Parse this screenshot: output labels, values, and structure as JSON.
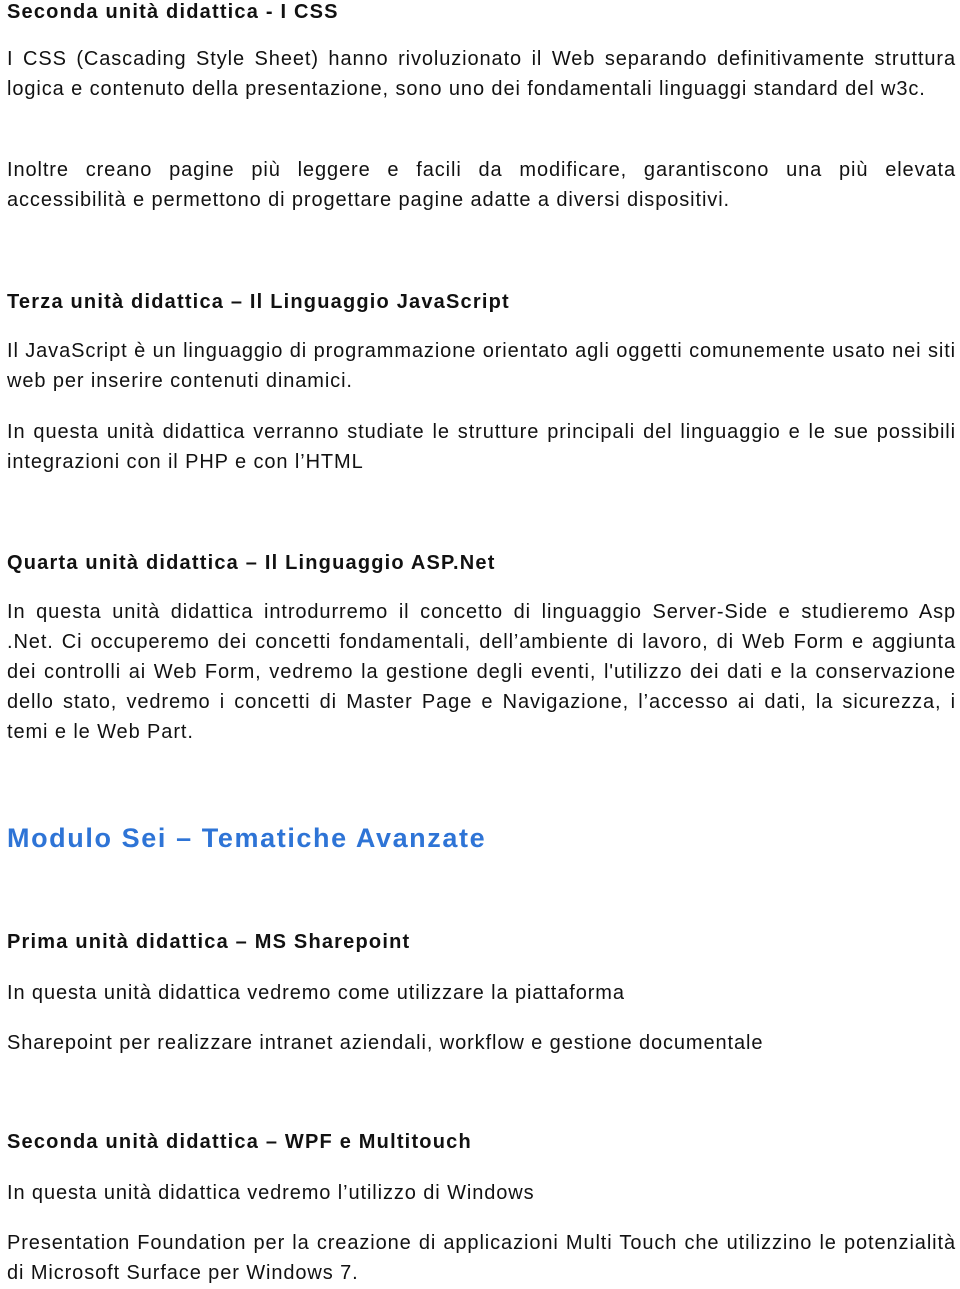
{
  "sections": [
    {
      "heading": "Seconda unità didattica - I CSS",
      "paragraphs": [
        "I CSS (Cascading Style Sheet) hanno rivoluzionato il Web separando definitivamente struttura logica e contenuto della presentazione, sono uno dei fondamentali linguaggi standard del w3c.",
        "Inoltre creano pagine più leggere e facili da modificare, garantiscono una più elevata accessibilità e permettono di progettare pagine adatte a diversi dispositivi."
      ]
    },
    {
      "heading": "Terza unità didattica – Il Linguaggio JavaScript",
      "paragraphs": [
        "Il JavaScript è un linguaggio di programmazione orientato agli oggetti comunemente usato nei siti web per inserire contenuti dinamici.",
        "In questa unità didattica verranno studiate le strutture principali del linguaggio e le sue possibili integrazioni con il PHP e con l’HTML"
      ]
    },
    {
      "heading": "Quarta unità didattica – Il Linguaggio ASP.Net",
      "paragraphs": [
        "In questa unità didattica introdurremo il concetto di linguaggio Server-Side e studieremo Asp .Net. Ci occuperemo dei concetti fondamentali, dell’ambiente di lavoro, di Web Form e aggiunta dei controlli ai Web Form, vedremo la gestione degli eventi, l'utilizzo dei dati e la conservazione dello stato, vedremo i concetti di Master Page e Navigazione, l’accesso ai dati, la sicurezza, i temi e le Web Part."
      ]
    }
  ],
  "module": {
    "title": "Modulo Sei – Tematiche Avanzate",
    "color": "#2e74d6",
    "sections": [
      {
        "heading": "Prima unità didattica – MS Sharepoint",
        "paragraphs": [
          "In questa unità didattica vedremo come utilizzare la piattaforma",
          "Sharepoint per realizzare intranet aziendali, workflow e gestione documentale"
        ]
      },
      {
        "heading": "Seconda unità didattica – WPF e Multitouch",
        "paragraphs": [
          "In questa unità didattica vedremo l’utilizzo di Windows",
          "Presentation Foundation per la creazione di applicazioni Multi Touch che utilizzino le potenzialità di Microsoft Surface per Windows 7."
        ]
      }
    ]
  }
}
